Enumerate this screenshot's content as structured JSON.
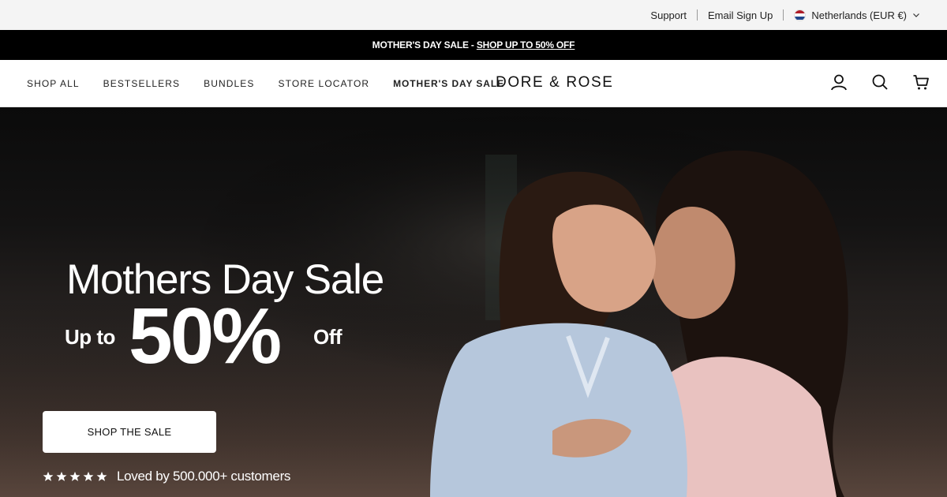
{
  "utility_bar": {
    "support": "Support",
    "email_signup": "Email Sign Up",
    "country": "Netherlands (EUR €)",
    "flag_colors": [
      "#ae1c28",
      "#ffffff",
      "#21468b"
    ]
  },
  "promo_bar": {
    "prefix": "MOTHER'S DAY SALE - ",
    "link": "SHOP UP TO 50% OFF"
  },
  "nav": {
    "items": [
      {
        "label": "SHOP ALL"
      },
      {
        "label": "BESTSELLERS"
      },
      {
        "label": "BUNDLES"
      },
      {
        "label": "STORE LOCATOR"
      },
      {
        "label": "MOTHER'S DAY SALE"
      }
    ],
    "logo": "DORE & ROSE",
    "icons": [
      "account-icon",
      "search-icon",
      "cart-icon"
    ]
  },
  "hero": {
    "title": "Mothers Day Sale",
    "up_to": "Up to",
    "percent": "50%",
    "off": "Off",
    "cta": "SHOP THE SALE",
    "rating_text": "Loved by 500.000+ customers",
    "stars": 5
  }
}
